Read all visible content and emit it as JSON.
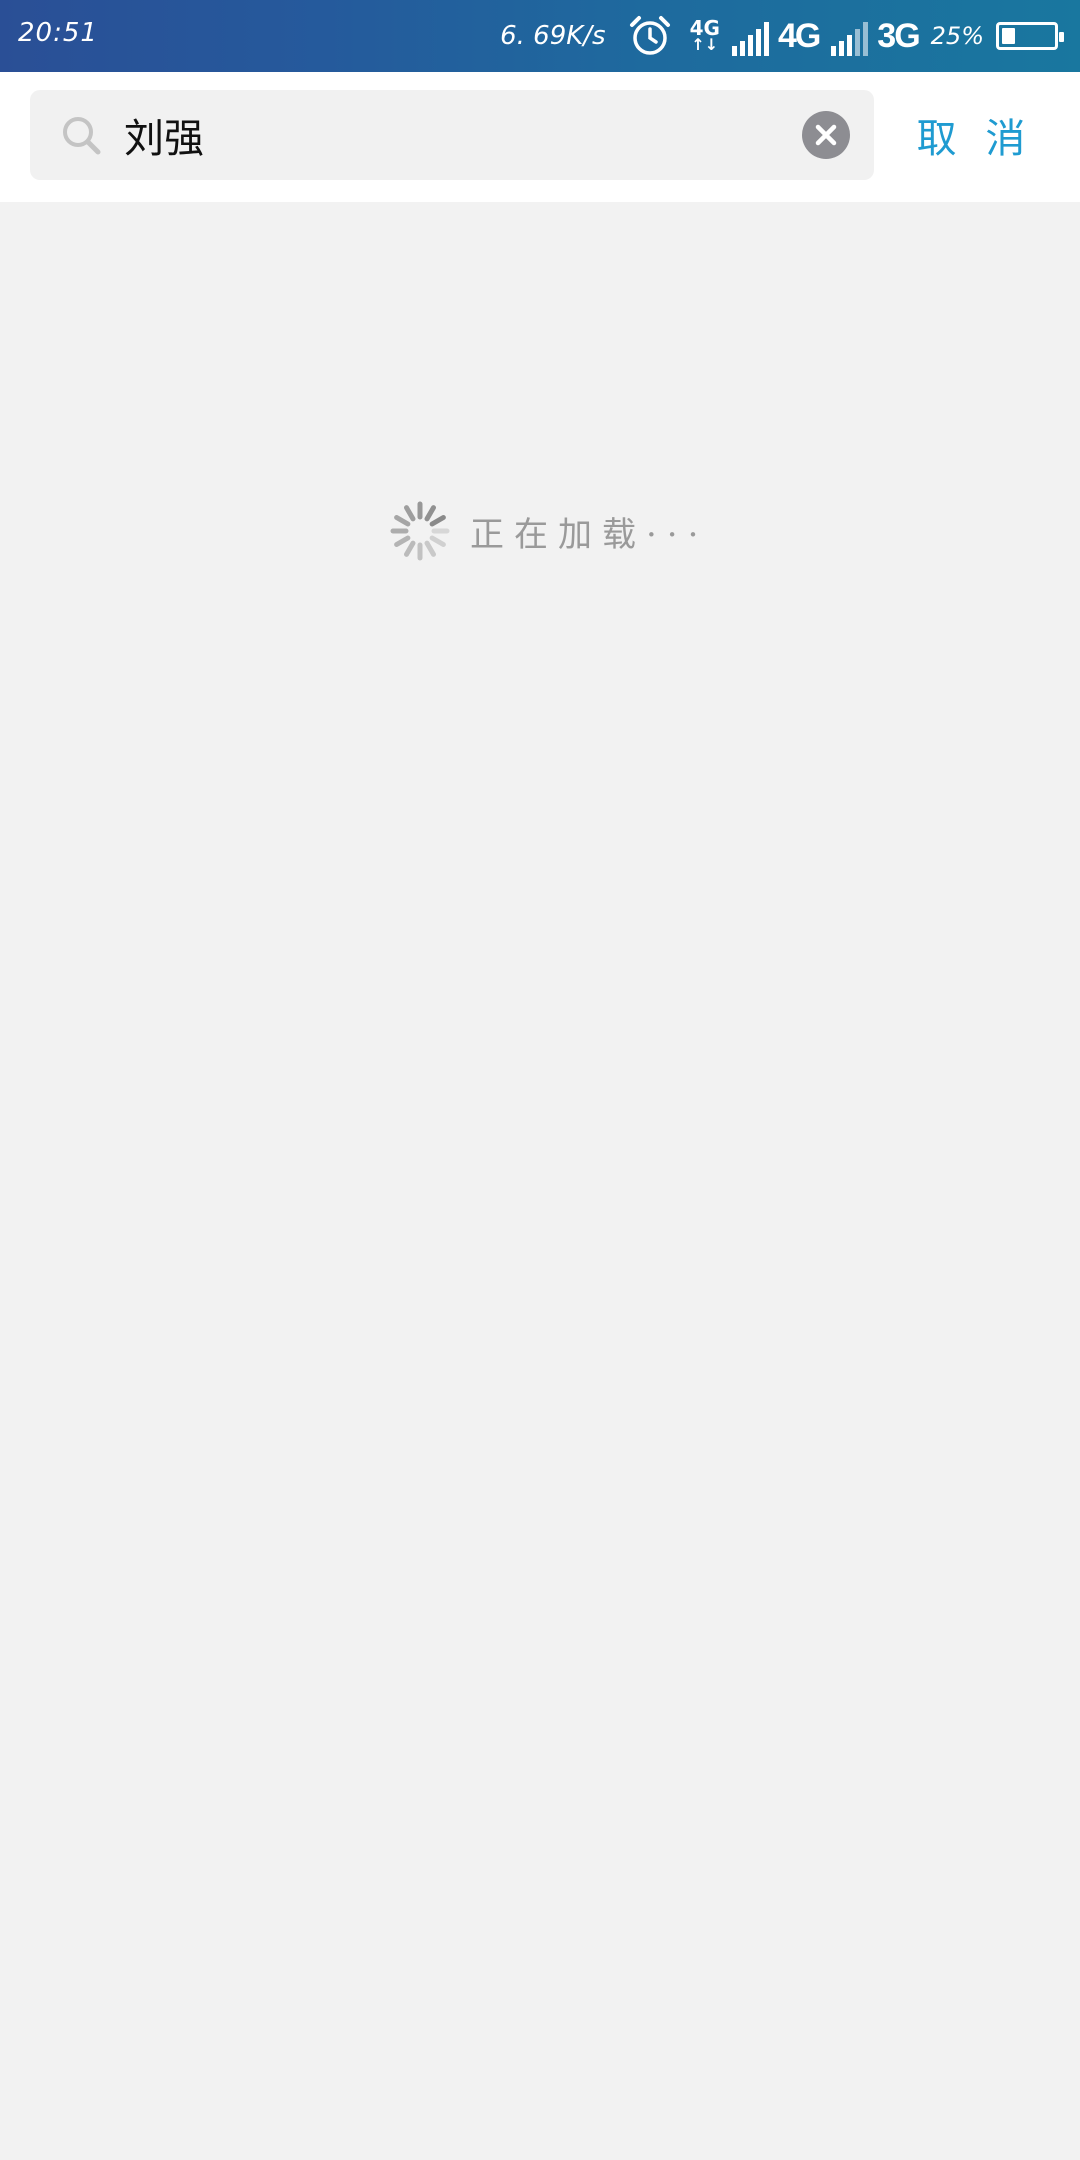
{
  "status_bar": {
    "time": "20:51",
    "net_speed": "6. 69K/s",
    "net_type_small": "4G",
    "net_arrows": "↑↓",
    "sim1_label": "4G",
    "sim2_label": "3G",
    "battery_percent": "25%",
    "battery_level": 0.25,
    "icons": [
      "alarm-clock-icon",
      "signal-bars-icon",
      "battery-icon"
    ]
  },
  "search": {
    "query": "刘强",
    "placeholder": "",
    "cancel_label": "取 消",
    "icons": [
      "search-icon",
      "clear-icon"
    ]
  },
  "content": {
    "loading_text": "正在加载···"
  },
  "colors": {
    "status_bar_start": "#2a4f96",
    "status_bar_end": "#19779f",
    "cancel_text": "#1f9bd1",
    "background": "#f2f2f2",
    "loading_text": "#9a9a9a",
    "clear_button": "#8d8d92"
  }
}
